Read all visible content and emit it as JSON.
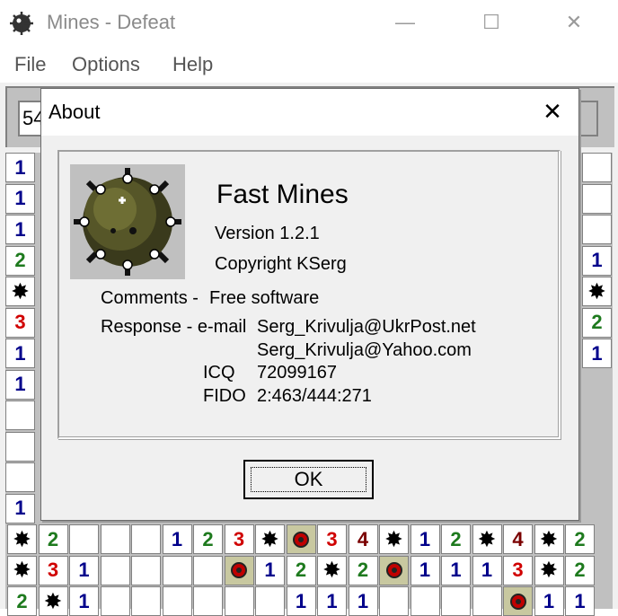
{
  "window": {
    "title": "Mines - Defeat",
    "minimize": "—",
    "maximize": "☐",
    "close": "✕"
  },
  "menu": {
    "items": [
      "File",
      "Options",
      "Help"
    ]
  },
  "counter_left": "54",
  "about": {
    "title": "About",
    "close": "✕",
    "app_name": "Fast Mines",
    "version": "Version 1.2.1",
    "copyright": "Copyright KSerg",
    "comments_label": "Comments -",
    "comments_value": "Free software",
    "response_label": "Response - e-mail",
    "email1": "Serg_Krivulja@UkrPost.net",
    "email2": "Serg_Krivulja@Yahoo.com",
    "icq_label": "ICQ",
    "icq_value": "72099167",
    "fido_label": "FIDO",
    "fido_value": "2:463/444:271",
    "ok": "OK"
  },
  "colors": {
    "1": "#00008b",
    "2": "#1e7a1e",
    "3": "#d00000",
    "4": "#7a0000"
  },
  "board": {
    "left_col": [
      "1",
      "1",
      "1",
      "2",
      "✸",
      "3",
      "1",
      "1",
      "",
      "",
      "",
      "1"
    ],
    "right_col": [
      "",
      "",
      "",
      "1",
      "✸",
      "2",
      "1"
    ],
    "bottom_rows": [
      [
        "✸",
        "2",
        "",
        "",
        "",
        "1",
        "2",
        "3",
        "✸",
        "●",
        "3",
        "4",
        "✸",
        "1",
        "2",
        "✸",
        "4",
        "✸",
        "2"
      ],
      [
        "✸",
        "3",
        "1",
        "",
        "",
        "",
        "",
        "●",
        "1",
        "2",
        "✸",
        "2",
        "●",
        "1",
        "1",
        "1",
        "3",
        "✸",
        "2"
      ],
      [
        "2",
        "✸",
        "1",
        "",
        "",
        "",
        "",
        "",
        "",
        "1",
        "1",
        "1",
        "",
        "",
        "",
        "",
        "●",
        "1",
        "1"
      ]
    ]
  }
}
